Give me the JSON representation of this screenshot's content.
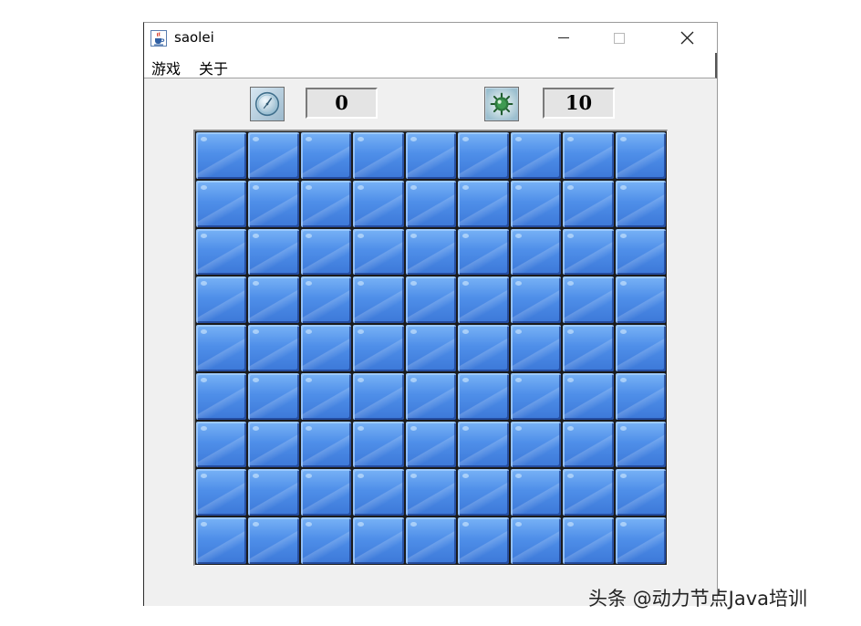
{
  "window": {
    "title": "saolei",
    "title_icon": "java-cup-icon",
    "controls": {
      "minimize_icon": "minimize-icon",
      "maximize_icon": "maximize-icon",
      "close_icon": "close-icon"
    }
  },
  "menu": {
    "items": [
      "游戏",
      "关于"
    ]
  },
  "status": {
    "timer_icon": "clock-icon",
    "timer_value": "0",
    "mines_icon": "mine-icon",
    "mines_value": "10"
  },
  "board": {
    "rows": 9,
    "cols": 9,
    "cell_state": "covered",
    "cell_color": "#4f8fe9"
  },
  "watermark": {
    "text": "头条 @动力节点Java培训"
  }
}
